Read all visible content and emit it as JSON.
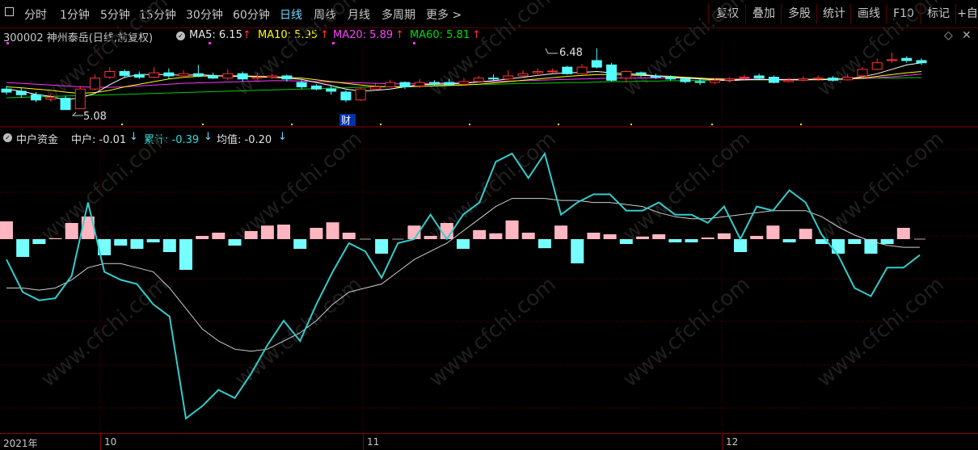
{
  "toolbar": {
    "periods": [
      "分时",
      "1分钟",
      "5分钟",
      "15分钟",
      "30分钟",
      "60分钟",
      "日线",
      "周线",
      "月线",
      "多周期",
      "更多 >"
    ],
    "active_period": "日线",
    "right_buttons": [
      "复权",
      "叠加",
      "多股",
      "统计",
      "画线",
      "F10",
      "标记",
      "+自"
    ]
  },
  "stock": {
    "title": "300002 神州泰岳(日线,前复权)",
    "ma5_label": "MA5: 6.15",
    "ma10_label": "MA10: 5.95",
    "ma20_label": "MA20: 5.89",
    "ma60_label": "MA60: 5.81",
    "high_label": "6.48",
    "low_label": "5.08",
    "event_marker": "财",
    "ma5_color": "#ffffff",
    "ma10_color": "#ffff00",
    "ma20_color": "#ff33ff",
    "ma60_color": "#00cc00"
  },
  "indicator": {
    "name": "中户资金",
    "v1_label": "中户: -0.01",
    "v2_label": "累计: -0.39",
    "v3_label": "均值: -0.20",
    "up_color": "#ffb6c1",
    "down_color": "#7ff",
    "line_color": "#33cccc"
  },
  "dates": {
    "year": "2021年",
    "oct": "10",
    "nov": "11",
    "dec": "12"
  },
  "watermark": "www.cfchi.com",
  "chart_data": {
    "type": "bar",
    "title": "中户资金",
    "series": [
      {
        "name": "中户",
        "values": [
          0.55,
          -0.55,
          -0.15,
          0.03,
          0.5,
          0.7,
          -0.5,
          -0.2,
          -0.3,
          -0.1,
          -0.4,
          -0.95,
          0.1,
          0.2,
          -0.2,
          0.25,
          0.42,
          0.45,
          -0.3,
          0.35,
          0.52,
          0.2,
          0.0,
          -0.45,
          0.0,
          0.42,
          0.1,
          0.5,
          -0.3,
          0.28,
          0.18,
          0.58,
          0.2,
          -0.28,
          0.42,
          -0.75,
          0.2,
          0.15,
          -0.15,
          0.08,
          0.15,
          -0.1,
          -0.1,
          0.05,
          0.18,
          -0.4,
          0.1,
          0.42,
          -0.1,
          0.32,
          -0.15,
          -0.45,
          -0.15,
          -0.45,
          -0.15,
          0.35,
          -0.01
        ]
      },
      {
        "name": "累计",
        "values": [
          -0.5,
          -1.3,
          -1.5,
          -1.45,
          -0.9,
          0.9,
          -0.8,
          -1.0,
          -1.1,
          -1.6,
          -1.9,
          -4.4,
          -4.1,
          -3.7,
          -3.9,
          -3.3,
          -2.6,
          -2.0,
          -2.5,
          -1.6,
          -0.8,
          -0.1,
          -0.3,
          -0.95,
          -0.1,
          0.0,
          0.6,
          0.0,
          0.6,
          0.9,
          1.9,
          2.1,
          1.5,
          2.1,
          0.6,
          0.9,
          1.1,
          1.1,
          0.7,
          0.7,
          0.9,
          0.6,
          0.6,
          0.4,
          0.8,
          0.0,
          0.8,
          0.7,
          1.2,
          0.9,
          0.1,
          -0.4,
          -1.2,
          -1.4,
          -0.7,
          -0.7,
          -0.39
        ]
      },
      {
        "name": "均值",
        "values": [
          -1.2,
          -1.2,
          -1.25,
          -1.2,
          -1.0,
          -0.7,
          -0.6,
          -0.6,
          -0.7,
          -0.8,
          -1.2,
          -1.7,
          -2.2,
          -2.5,
          -2.7,
          -2.75,
          -2.7,
          -2.5,
          -2.3,
          -2.0,
          -1.6,
          -1.3,
          -1.2,
          -1.1,
          -0.8,
          -0.5,
          -0.3,
          -0.1,
          0.2,
          0.5,
          0.8,
          1.0,
          1.0,
          1.0,
          0.95,
          0.95,
          0.9,
          0.9,
          0.85,
          0.8,
          0.65,
          0.55,
          0.5,
          0.5,
          0.55,
          0.6,
          0.65,
          0.7,
          0.7,
          0.7,
          0.55,
          0.3,
          0.1,
          -0.05,
          -0.15,
          -0.2,
          -0.2
        ]
      }
    ],
    "ylim": [
      -4.5,
      2.3
    ]
  },
  "candles": [
    [
      5.55,
      5.48,
      5.62,
      5.42
    ],
    [
      5.5,
      5.42,
      5.58,
      5.35
    ],
    [
      5.42,
      5.3,
      5.48,
      5.25
    ],
    [
      5.32,
      5.36,
      5.44,
      5.28
    ],
    [
      5.34,
      5.08,
      5.4,
      5.08
    ],
    [
      5.1,
      5.55,
      5.62,
      5.1
    ],
    [
      5.55,
      5.8,
      5.88,
      5.52
    ],
    [
      5.82,
      5.95,
      6.05,
      5.78
    ],
    [
      5.95,
      5.86,
      6.0,
      5.8
    ],
    [
      5.88,
      5.82,
      5.95,
      5.78
    ],
    [
      5.82,
      5.92,
      6.05,
      5.8
    ],
    [
      5.92,
      5.85,
      6.02,
      5.78
    ],
    [
      5.85,
      5.9,
      5.98,
      5.8
    ],
    [
      5.9,
      5.85,
      6.1,
      5.82
    ],
    [
      5.85,
      5.8,
      5.92,
      5.78
    ],
    [
      5.8,
      5.9,
      6.0,
      5.76
    ],
    [
      5.9,
      5.78,
      5.95,
      5.72
    ],
    [
      5.8,
      5.82,
      5.92,
      5.76
    ],
    [
      5.82,
      5.85,
      5.9,
      5.78
    ],
    [
      5.85,
      5.78,
      5.88,
      5.72
    ],
    [
      5.7,
      5.6,
      5.75,
      5.55
    ],
    [
      5.62,
      5.55,
      5.66,
      5.52
    ],
    [
      5.55,
      5.5,
      5.62,
      5.42
    ],
    [
      5.48,
      5.3,
      5.52,
      5.25
    ],
    [
      5.3,
      5.55,
      5.6,
      5.28
    ],
    [
      5.55,
      5.6,
      5.68,
      5.52
    ],
    [
      5.6,
      5.7,
      5.76,
      5.58
    ],
    [
      5.7,
      5.6,
      5.72,
      5.55
    ],
    [
      5.62,
      5.7,
      5.78,
      5.58
    ],
    [
      5.7,
      5.68,
      5.75,
      5.62
    ],
    [
      5.7,
      5.65,
      5.78,
      5.62
    ],
    [
      5.66,
      5.72,
      5.8,
      5.62
    ],
    [
      5.72,
      5.8,
      5.85,
      5.7
    ],
    [
      5.8,
      5.78,
      5.88,
      5.75
    ],
    [
      5.78,
      5.85,
      5.98,
      5.76
    ],
    [
      5.85,
      5.9,
      5.98,
      5.82
    ],
    [
      5.92,
      5.95,
      6.02,
      5.85
    ],
    [
      5.95,
      5.96,
      6.02,
      5.92
    ],
    [
      6.05,
      5.9,
      6.08,
      5.88
    ],
    [
      5.9,
      6.05,
      6.12,
      5.88
    ],
    [
      6.2,
      6.05,
      6.48,
      6.02
    ],
    [
      6.1,
      5.75,
      6.15,
      5.72
    ],
    [
      5.8,
      5.95,
      5.98,
      5.7
    ],
    [
      5.92,
      5.88,
      5.95,
      5.82
    ],
    [
      5.85,
      5.82,
      5.9,
      5.78
    ],
    [
      5.82,
      5.78,
      5.86,
      5.74
    ],
    [
      5.78,
      5.72,
      5.82,
      5.68
    ],
    [
      5.72,
      5.7,
      5.78,
      5.64
    ],
    [
      5.7,
      5.75,
      5.8,
      5.66
    ],
    [
      5.75,
      5.78,
      5.82,
      5.7
    ],
    [
      5.8,
      5.82,
      5.88,
      5.76
    ],
    [
      5.85,
      5.8,
      5.9,
      5.78
    ],
    [
      5.82,
      5.7,
      5.86,
      5.68
    ],
    [
      5.72,
      5.75,
      5.8,
      5.7
    ],
    [
      5.75,
      5.78,
      5.84,
      5.72
    ],
    [
      5.78,
      5.8,
      5.86,
      5.74
    ],
    [
      5.8,
      5.75,
      5.84,
      5.72
    ],
    [
      5.76,
      5.82,
      5.9,
      5.74
    ],
    [
      5.85,
      6.0,
      6.05,
      5.82
    ],
    [
      6.0,
      6.15,
      6.25,
      5.98
    ],
    [
      6.2,
      6.22,
      6.38,
      6.15
    ],
    [
      6.25,
      6.2,
      6.3,
      6.15
    ],
    [
      6.2,
      6.15,
      6.25,
      6.1
    ]
  ],
  "ma_lines": {
    "ma5": [
      5.55,
      5.5,
      5.43,
      5.38,
      5.3,
      5.35,
      5.45,
      5.65,
      5.82,
      5.88,
      5.88,
      5.88,
      5.86,
      5.88,
      5.86,
      5.84,
      5.84,
      5.83,
      5.82,
      5.8,
      5.77,
      5.7,
      5.63,
      5.55,
      5.5,
      5.52,
      5.55,
      5.6,
      5.65,
      5.66,
      5.67,
      5.68,
      5.71,
      5.74,
      5.78,
      5.82,
      5.86,
      5.9,
      5.92,
      5.93,
      5.95,
      5.92,
      5.9,
      5.88,
      5.85,
      5.82,
      5.8,
      5.78,
      5.76,
      5.74,
      5.76,
      5.77,
      5.76,
      5.76,
      5.76,
      5.77,
      5.77,
      5.78,
      5.83,
      5.9,
      6.0,
      6.1,
      6.15
    ],
    "ma10": [
      5.6,
      5.58,
      5.55,
      5.52,
      5.48,
      5.45,
      5.47,
      5.52,
      5.6,
      5.66,
      5.72,
      5.78,
      5.82,
      5.84,
      5.85,
      5.85,
      5.85,
      5.84,
      5.83,
      5.82,
      5.8,
      5.76,
      5.72,
      5.68,
      5.64,
      5.61,
      5.6,
      5.6,
      5.61,
      5.62,
      5.63,
      5.64,
      5.66,
      5.69,
      5.72,
      5.75,
      5.78,
      5.81,
      5.84,
      5.86,
      5.88,
      5.88,
      5.87,
      5.86,
      5.85,
      5.84,
      5.82,
      5.8,
      5.78,
      5.77,
      5.76,
      5.76,
      5.76,
      5.76,
      5.76,
      5.76,
      5.77,
      5.78,
      5.8,
      5.84,
      5.88,
      5.92,
      5.95
    ],
    "ma20": [
      5.7,
      5.68,
      5.66,
      5.64,
      5.62,
      5.6,
      5.59,
      5.59,
      5.6,
      5.62,
      5.64,
      5.66,
      5.68,
      5.69,
      5.7,
      5.71,
      5.72,
      5.73,
      5.74,
      5.74,
      5.73,
      5.72,
      5.71,
      5.7,
      5.69,
      5.68,
      5.67,
      5.67,
      5.67,
      5.68,
      5.69,
      5.7,
      5.71,
      5.72,
      5.73,
      5.74,
      5.75,
      5.76,
      5.77,
      5.78,
      5.79,
      5.8,
      5.8,
      5.8,
      5.8,
      5.8,
      5.8,
      5.79,
      5.79,
      5.78,
      5.78,
      5.77,
      5.77,
      5.77,
      5.77,
      5.77,
      5.77,
      5.78,
      5.79,
      5.81,
      5.83,
      5.86,
      5.89
    ],
    "ma60": [
      5.35,
      5.36,
      5.37,
      5.38,
      5.39,
      5.4,
      5.41,
      5.42,
      5.43,
      5.44,
      5.45,
      5.46,
      5.47,
      5.48,
      5.49,
      5.5,
      5.51,
      5.52,
      5.53,
      5.54,
      5.55,
      5.56,
      5.57,
      5.58,
      5.59,
      5.6,
      5.6,
      5.61,
      5.62,
      5.63,
      5.64,
      5.65,
      5.66,
      5.66,
      5.67,
      5.68,
      5.68,
      5.69,
      5.7,
      5.7,
      5.71,
      5.72,
      5.72,
      5.73,
      5.73,
      5.74,
      5.74,
      5.75,
      5.75,
      5.76,
      5.76,
      5.77,
      5.77,
      5.77,
      5.78,
      5.78,
      5.78,
      5.79,
      5.79,
      5.8,
      5.8,
      5.81,
      5.81
    ]
  }
}
